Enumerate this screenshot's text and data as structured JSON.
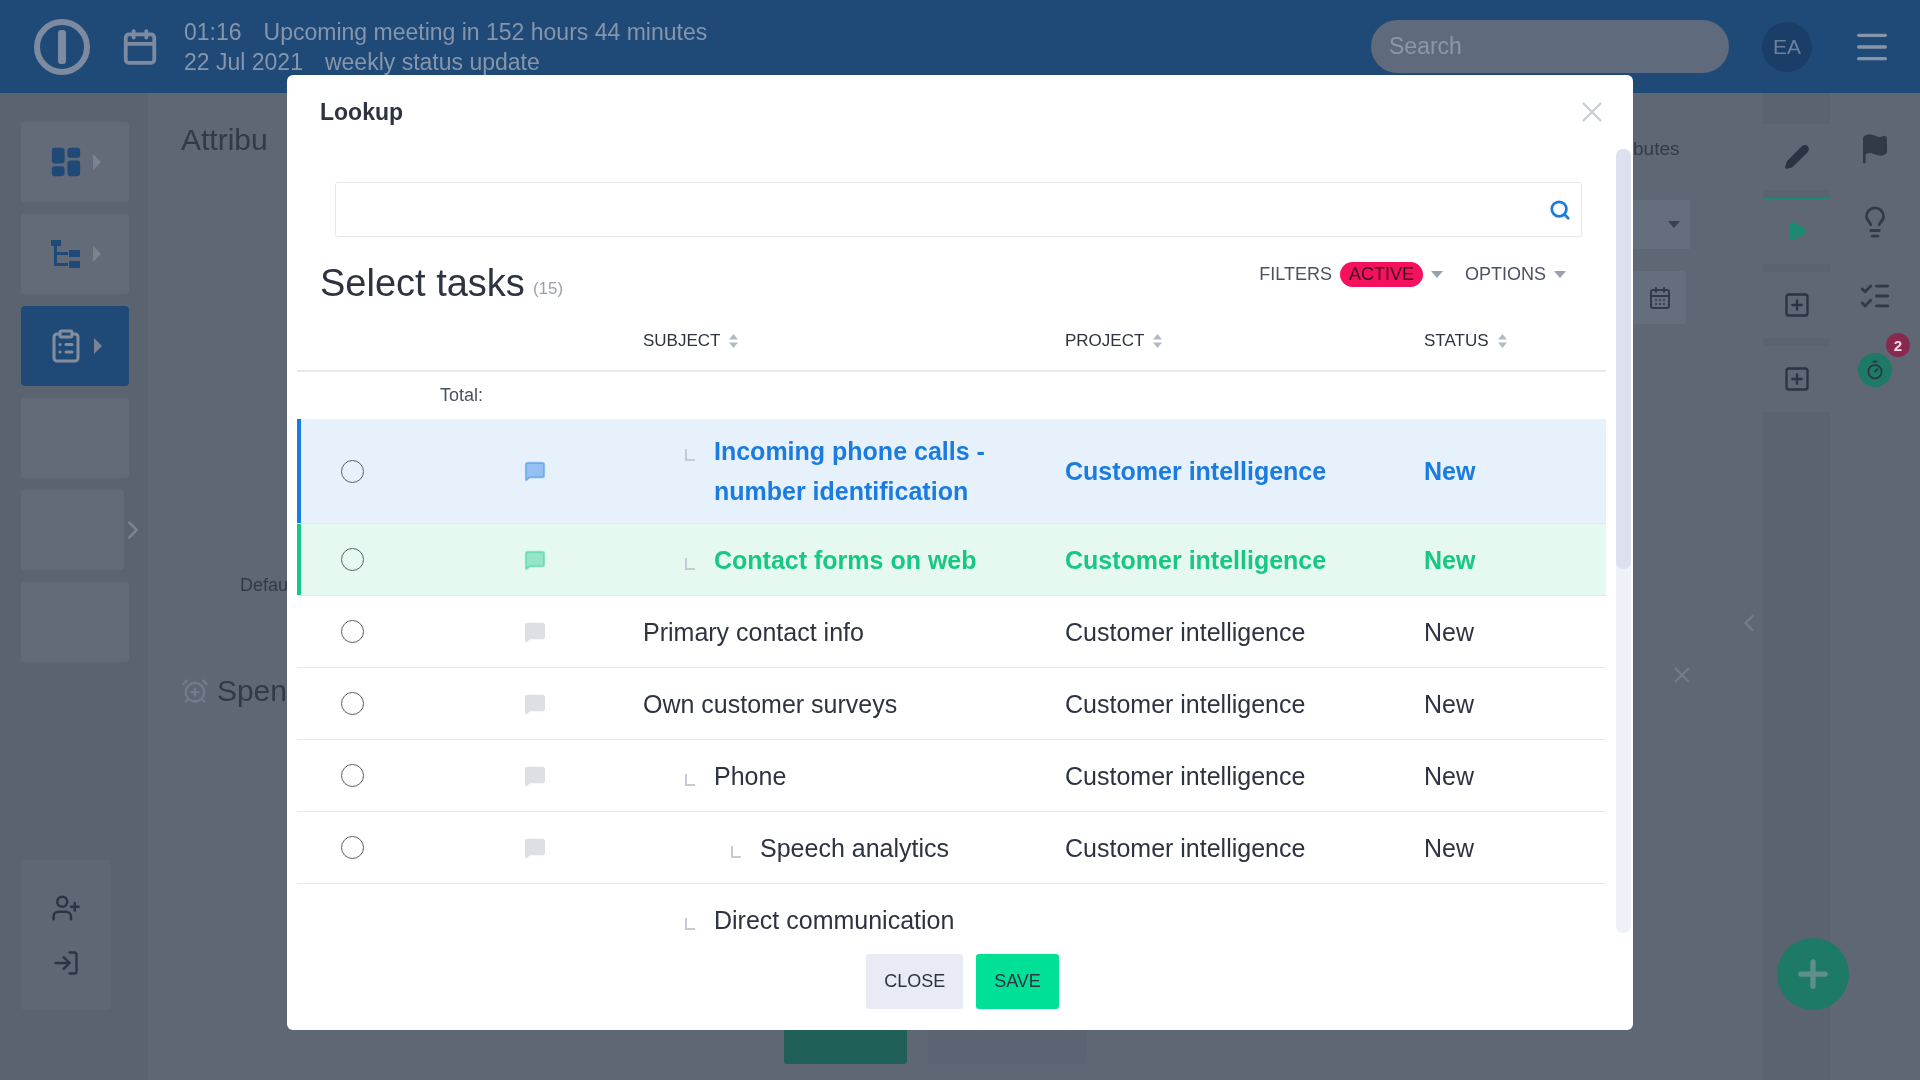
{
  "top_bar": {
    "time": "01:16",
    "meeting": "Upcoming meeting in 152 hours 44 minutes",
    "date": "22 Jul 2021",
    "event": "weekly status update",
    "search": {
      "placeholder": "Search"
    },
    "avatar": "EA"
  },
  "sidebar": {
    "items": [
      {
        "kind": "dashboard",
        "selected": false
      },
      {
        "kind": "tree",
        "selected": false
      },
      {
        "kind": "tasks",
        "selected": true
      },
      {
        "kind": "empty",
        "selected": false
      },
      {
        "kind": "empty",
        "selected": false
      },
      {
        "kind": "empty",
        "selected": false
      }
    ]
  },
  "background": {
    "title": "Attribu",
    "label": "Defau",
    "section": "Spen",
    "right_label": "butes"
  },
  "right_toolbar": {
    "badge": "2"
  },
  "modal": {
    "title": "Lookup",
    "heading": "Select tasks",
    "count": "(15)",
    "filters_label": "FILTERS",
    "filters_badge": "ACTIVE",
    "options_label": "OPTIONS",
    "columns": [
      "SUBJECT",
      "PROJECT",
      "STATUS"
    ],
    "total_label": "Total:",
    "tasks": [
      {
        "children": [
          {
            "subject": "Incoming phone calls - number identification",
            "project": "Customer intelligence",
            "status": "New",
            "checked": false,
            "color": "#1a7be0"
          },
          {
            "subject": "Contact forms on web",
            "project": "Customer intelligence",
            "status": "New",
            "checked": false,
            "color": "#17c884"
          }
        ]
      },
      {
        "subject": "Primary contact info",
        "project": "Customer intelligence",
        "status": "New",
        "checked": false
      },
      {
        "subject": "Own customer surveys",
        "project": "Customer intelligence",
        "status": "New",
        "checked": false,
        "children": [
          {
            "subject": "Phone",
            "project": "Customer intelligence",
            "status": "New",
            "checked": false,
            "children": [
              {
                "subject": "Speech analytics",
                "project": "Customer intelligence",
                "status": "New",
                "checked": false
              }
            ]
          },
          {
            "subject": "Direct communication"
          }
        ]
      }
    ],
    "buttons": [
      {
        "label": "CLOSE",
        "kind": "secondary"
      },
      {
        "label": "SAVE",
        "kind": "primary"
      }
    ]
  }
}
